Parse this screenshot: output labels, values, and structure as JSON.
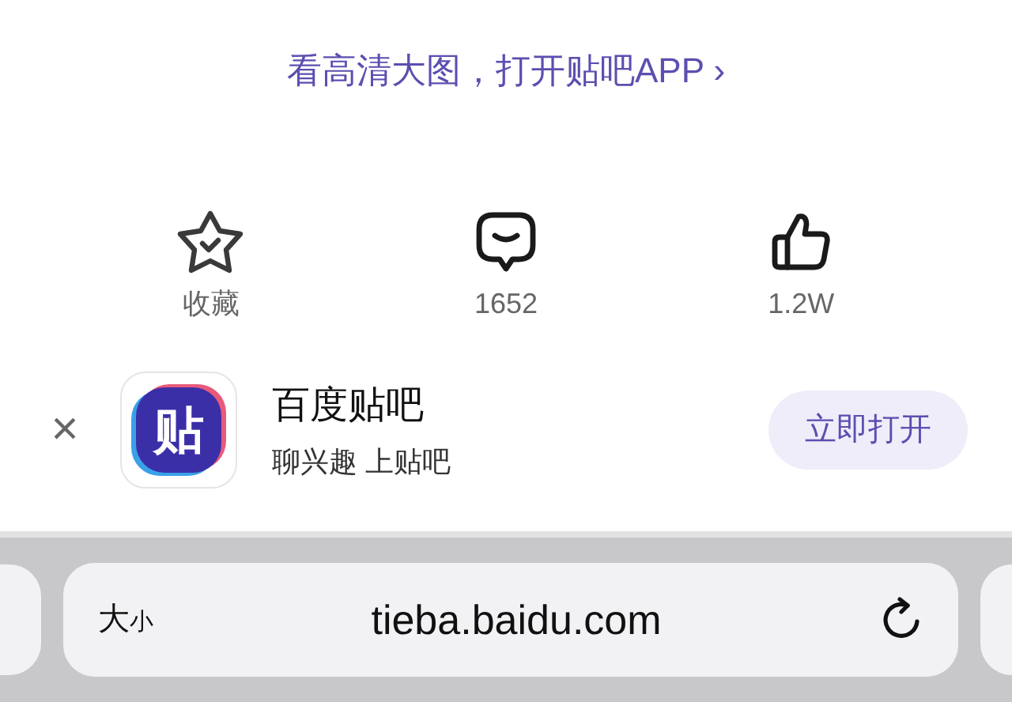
{
  "open_app_link": {
    "label": "看高清大图，打开贴吧APP ›"
  },
  "actions": [
    {
      "kind": "star",
      "label": "收藏"
    },
    {
      "kind": "comment",
      "label": "1652"
    },
    {
      "kind": "like",
      "label": "1.2W"
    }
  ],
  "app_banner": {
    "close": "×",
    "logo_text": "贴",
    "name": "百度贴吧",
    "slogan": "聊兴趣 上贴吧",
    "button": "立即打开"
  },
  "address_bar": {
    "text_size": "大",
    "text_size_small": "小",
    "url": "tieba.baidu.com"
  }
}
